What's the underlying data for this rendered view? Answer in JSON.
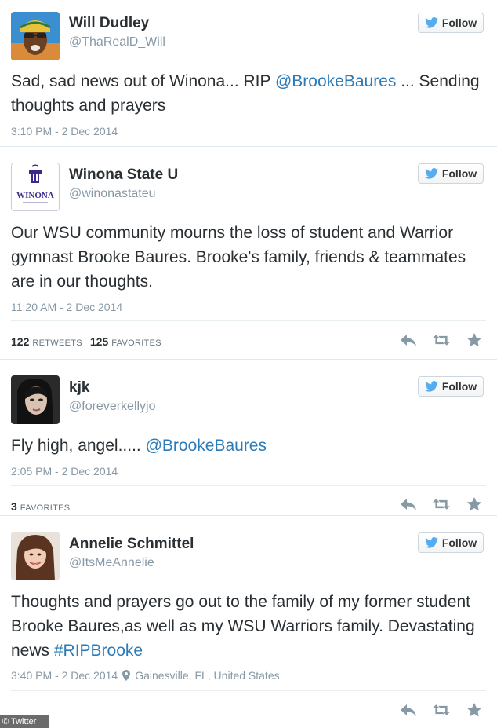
{
  "follow_label": "Follow",
  "tweets": [
    {
      "name": "Will Dudley",
      "handle": "@ThaRealD_Will",
      "text_parts": [
        "Sad, sad news out of Winona... RIP ",
        "@BrookeBaures",
        " ... Sending thoughts and prayers"
      ],
      "timestamp": "3:10 PM - 2 Dec 2014"
    },
    {
      "name": "Winona State U",
      "handle": "@winonastateu",
      "avatar_text": "WINONA",
      "text_parts": [
        "Our WSU community mourns the loss of student and Warrior gymnast Brooke Baures. Brooke's family, friends & teammates are in our thoughts."
      ],
      "timestamp": "11:20 AM - 2 Dec 2014",
      "retweets": "122",
      "retweets_label": "RETWEETS",
      "favorites": "125",
      "favorites_label": "FAVORITES"
    },
    {
      "name": "kjk",
      "handle": "@foreverkellyjo",
      "text_parts": [
        "Fly high, angel..... ",
        "@BrookeBaures"
      ],
      "timestamp": "2:05 PM - 2 Dec 2014",
      "favorites": "3",
      "favorites_label": "FAVORITES"
    },
    {
      "name": "Annelie Schmittel",
      "handle": "@ItsMeAnnelie",
      "text_parts": [
        "Thoughts and prayers go out to the family of my former student Brooke Baures,as well as my WSU Warriors family. Devastating news ",
        "#RIPBrooke"
      ],
      "timestamp": "3:40 PM - 2 Dec 2014",
      "location": "Gainesville, FL, United States"
    }
  ],
  "credit": "© Twitter",
  "colors": {
    "link": "#2b7bb9",
    "muted": "#8899a6",
    "text": "#292f33",
    "twitter_bird": "#55acee"
  }
}
